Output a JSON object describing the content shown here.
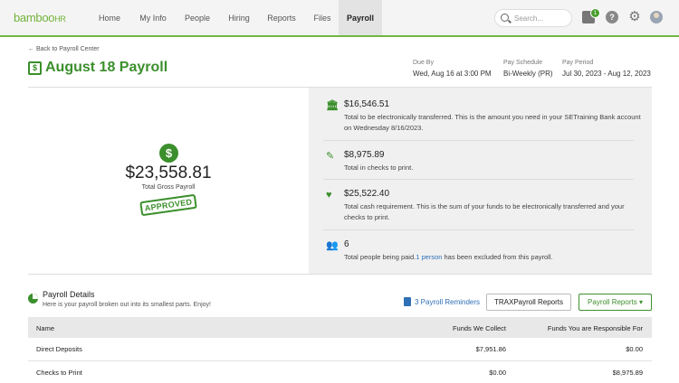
{
  "nav": {
    "logo_main": "bamboo",
    "logo_sub": "HR",
    "items": [
      "Home",
      "My Info",
      "People",
      "Hiring",
      "Reports",
      "Files",
      "Payroll"
    ],
    "active": "Payroll",
    "search_placeholder": "Search...",
    "inbox_count": "1",
    "help_label": "?"
  },
  "header": {
    "back_link": "← Back to Payroll Center",
    "title": "August 18 Payroll",
    "due_by_label": "Due By",
    "due_by_value": "Wed, Aug 16 at 3:00 PM",
    "pay_schedule_label": "Pay Schedule",
    "pay_schedule_value": "Bi-Weekly (PR)",
    "pay_period_label": "Pay Period",
    "pay_period_value": "Jul 30, 2023 - Aug 12, 2023"
  },
  "summary": {
    "gross_amount": "$23,558.81",
    "gross_label": "Total Gross Payroll",
    "status_stamp": "APPROVED",
    "items": [
      {
        "icon": "bank-icon",
        "amount": "$16,546.51",
        "desc": "Total to be electronically transferred. This is the amount you need in your SETraining Bank account on Wednesday 8/16/2023."
      },
      {
        "icon": "check-print-icon",
        "amount": "$8,975.89",
        "desc": "Total in checks to print."
      },
      {
        "icon": "money-heart-icon",
        "amount": "$25,522.40",
        "desc": "Total cash requirement. This is the sum of your funds to be electronically transferred and your checks to print."
      },
      {
        "icon": "people-icon",
        "amount": "6",
        "desc_pre": "Total people being paid.",
        "desc_link": "1 person",
        "desc_post": " has been excluded from this payroll."
      }
    ]
  },
  "details": {
    "title": "Payroll Details",
    "subtitle": "Here is your payroll broken out into its smallest parts. Enjoy!",
    "reminders_link": "3 Payroll Reminders",
    "trax_button": "TRAXPayroll Reports",
    "reports_button": "Payroll Reports",
    "columns": [
      "Name",
      "Funds We Collect",
      "Funds You are Responsible For"
    ],
    "rows": [
      {
        "name": "Direct Deposits",
        "collect": "$7,951.86",
        "responsible": "$0.00"
      },
      {
        "name": "Checks to Print",
        "collect": "$0.00",
        "responsible": "$8,975.89"
      }
    ]
  },
  "colors": {
    "brand_green": "#3b8f2c",
    "link_blue": "#2f6fb6"
  }
}
